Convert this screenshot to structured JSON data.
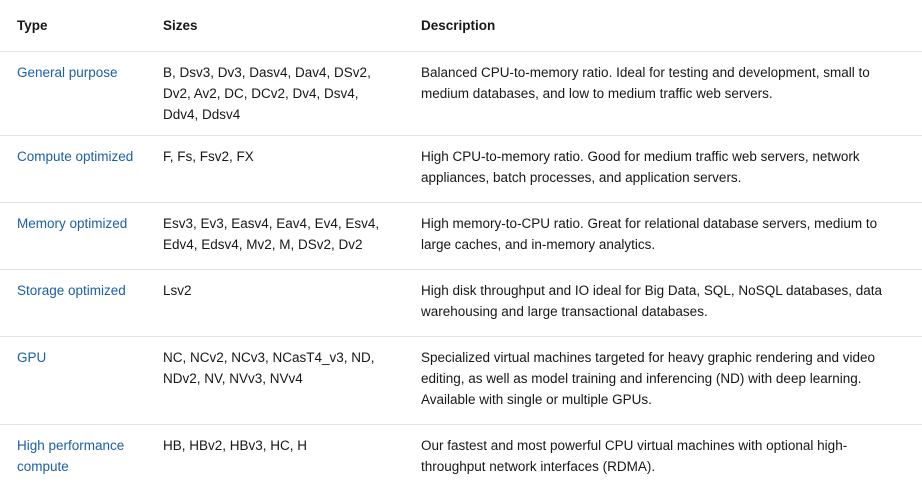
{
  "table": {
    "headers": [
      "Type",
      "Sizes",
      "Description"
    ],
    "rows": [
      {
        "type": "General purpose",
        "sizes": "B, Dsv3, Dv3, Dasv4, Dav4, DSv2, Dv2, Av2, DC, DCv2, Dv4, Dsv4, Ddv4, Ddsv4",
        "description": "Balanced CPU-to-memory ratio. Ideal for testing and development, small to medium databases, and low to medium traffic web servers."
      },
      {
        "type": "Compute optimized",
        "sizes": "F, Fs, Fsv2, FX",
        "description": "High CPU-to-memory ratio. Good for medium traffic web servers, network appliances, batch processes, and application servers."
      },
      {
        "type": "Memory optimized",
        "sizes": "Esv3, Ev3, Easv4, Eav4, Ev4, Esv4, Edv4, Edsv4, Mv2, M, DSv2, Dv2",
        "description": "High memory-to-CPU ratio. Great for relational database servers, medium to large caches, and in-memory analytics."
      },
      {
        "type": "Storage optimized",
        "sizes": "Lsv2",
        "description": "High disk throughput and IO ideal for Big Data, SQL, NoSQL databases, data warehousing and large transactional databases."
      },
      {
        "type": "GPU",
        "sizes": "NC, NCv2, NCv3, NCasT4_v3, ND, NDv2, NV, NVv3, NVv4",
        "description": "Specialized virtual machines targeted for heavy graphic rendering and video editing, as well as model training and inferencing (ND) with deep learning. Available with single or multiple GPUs."
      },
      {
        "type": "High performance compute",
        "sizes": "HB, HBv2, HBv3, HC, H",
        "description": "Our fastest and most powerful CPU virtual machines with optional high-throughput network interfaces (RDMA)."
      }
    ]
  },
  "colors": {
    "link": "#1a5fa9",
    "text": "#171717",
    "border": "#e3e3e3"
  }
}
